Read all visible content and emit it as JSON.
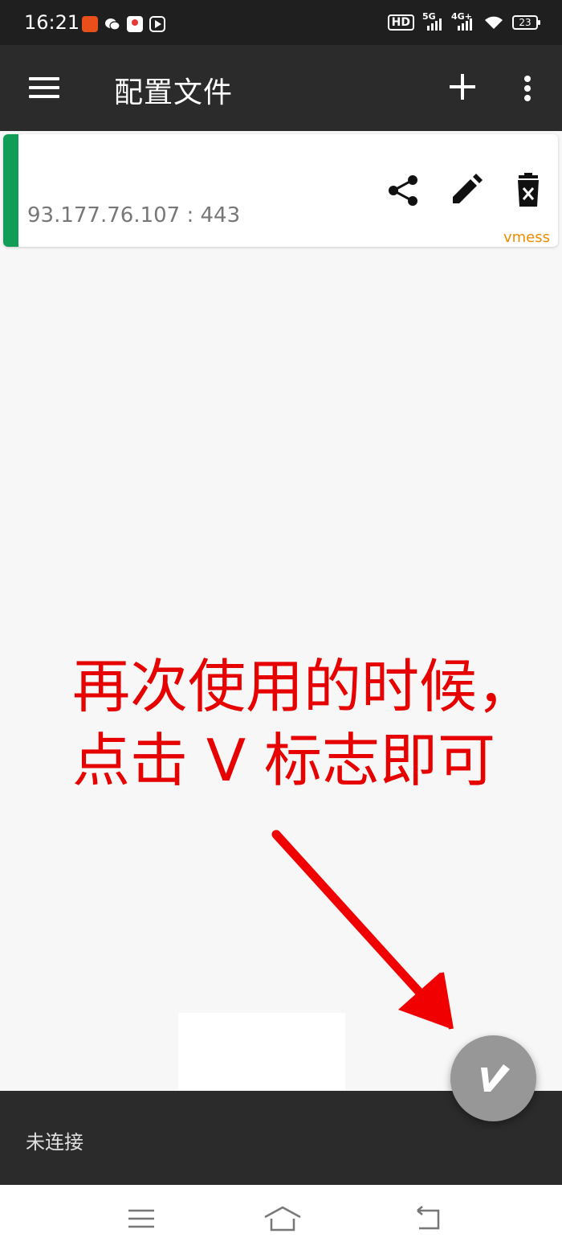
{
  "status_bar": {
    "time": "16:21",
    "notification_icons": [
      "app-icon",
      "wechat-icon",
      "map-pin-icon",
      "play-icon"
    ],
    "hd_label": "HD",
    "network_5g": "5G",
    "network_4g": "4G+",
    "battery_level": "23"
  },
  "app_bar": {
    "title": "配置文件"
  },
  "profiles": [
    {
      "address": "93.177.76.107 : 443",
      "protocol": "vmess",
      "selected_color": "#0f9d58"
    }
  ],
  "annotation": {
    "line1": "再次使用的时候，",
    "line2": "点击 V 标志即可",
    "color": "#e60000"
  },
  "connection": {
    "status": "未连接"
  },
  "colors": {
    "app_bar": "#2b2b2b",
    "fab": "#979797",
    "protocol": "#f08c00"
  }
}
